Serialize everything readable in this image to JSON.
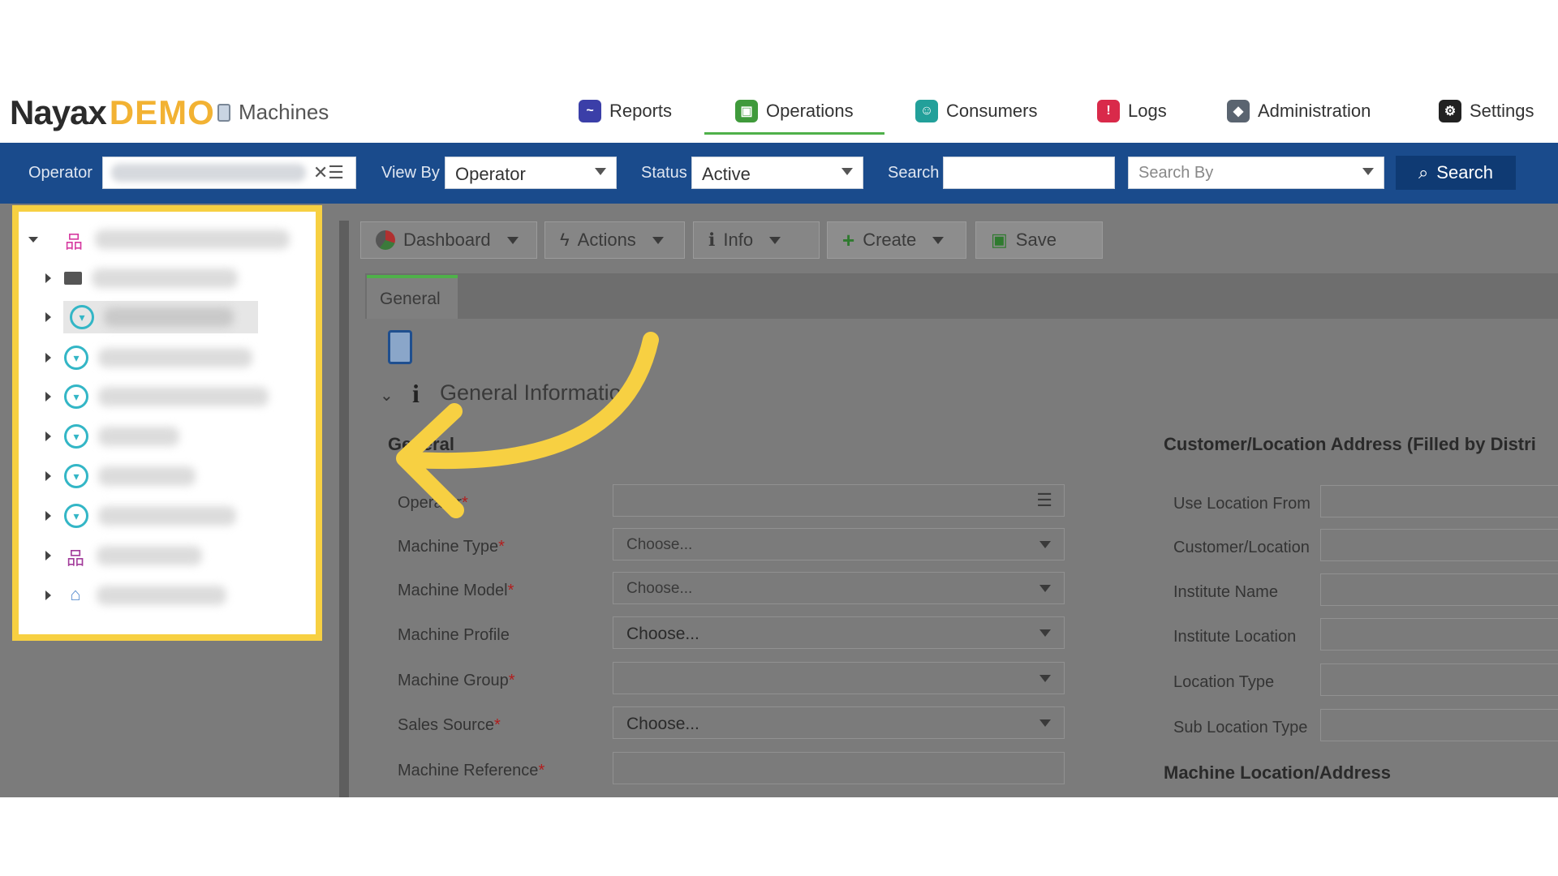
{
  "header": {
    "logo_main": "Nayax",
    "logo_accent": "DEMO",
    "app_title": "Machines",
    "nav": [
      {
        "label": "Reports",
        "icon": "reports-icon",
        "color": "#3b3fa8"
      },
      {
        "label": "Operations",
        "icon": "operations-icon",
        "color": "#3f9a3b"
      },
      {
        "label": "Consumers",
        "icon": "consumers-icon",
        "color": "#22a09a"
      },
      {
        "label": "Logs",
        "icon": "logs-icon",
        "color": "#d92a4a"
      },
      {
        "label": "Administration",
        "icon": "administration-icon",
        "color": "#5a6470"
      },
      {
        "label": "Settings",
        "icon": "gear-icon",
        "color": "#222222"
      }
    ]
  },
  "filters": {
    "operator_label": "Operator",
    "view_by_label": "View By",
    "view_by_value": "Operator",
    "status_label": "Status",
    "status_value": "Active",
    "search_label": "Search",
    "search_by_placeholder": "Search By",
    "search_button": "Search"
  },
  "toolbar": {
    "dashboard": "Dashboard",
    "actions": "Actions",
    "info": "Info",
    "create": "Create",
    "save": "Save"
  },
  "tabs": {
    "general": "General"
  },
  "section": {
    "title": "General Information",
    "left_heading": "General",
    "right_heading": "Customer/Location Address (Filled by Distri",
    "bottom_heading": "Machine Location/Address"
  },
  "fields": [
    {
      "label": "Operator",
      "required": true,
      "value": "",
      "kind": "list"
    },
    {
      "label": "Machine Type",
      "required": true,
      "value": "Choose...",
      "kind": "select"
    },
    {
      "label": "Machine Model",
      "required": true,
      "value": "Choose...",
      "kind": "select"
    },
    {
      "label": "Machine Profile",
      "required": false,
      "value": "Choose...",
      "kind": "select2"
    },
    {
      "label": "Machine Group",
      "required": true,
      "value": "",
      "kind": "select2"
    },
    {
      "label": "Sales Source",
      "required": true,
      "value": "Choose...",
      "kind": "select2"
    },
    {
      "label": "Machine Reference",
      "required": true,
      "value": "",
      "kind": "text"
    }
  ],
  "right_fields": [
    "Use Location From",
    "Customer/Location",
    "Institute Name",
    "Institute Location",
    "Location Type",
    "Sub Location Type"
  ],
  "annotation": {
    "highlight_color": "#f7d042",
    "arrow_color": "#f7d042"
  }
}
